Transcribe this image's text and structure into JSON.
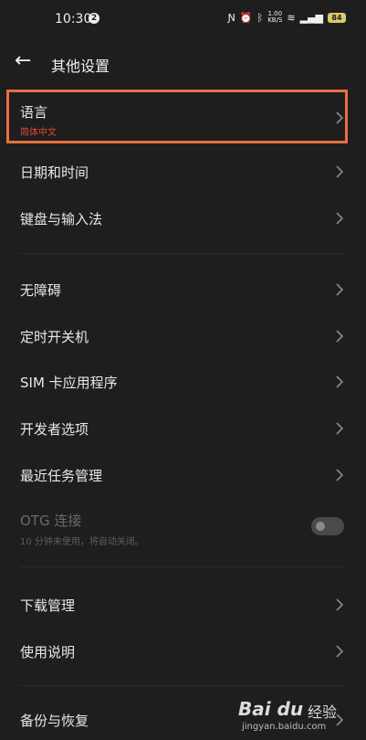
{
  "status": {
    "time": "10:30",
    "notification_count": "2",
    "speed_value": "1.00",
    "speed_unit": "KB/S",
    "battery": "84"
  },
  "header": {
    "title": "其他设置"
  },
  "items": {
    "language": {
      "label": "语言",
      "value": "简体中文"
    },
    "datetime": {
      "label": "日期和时间"
    },
    "keyboard": {
      "label": "键盘与输入法"
    },
    "accessibility": {
      "label": "无障碍"
    },
    "schedule_power": {
      "label": "定时开关机"
    },
    "sim_apps": {
      "label": "SIM 卡应用程序"
    },
    "developer": {
      "label": "开发者选项"
    },
    "recent_tasks": {
      "label": "最近任务管理"
    },
    "otg": {
      "label": "OTG 连接",
      "sub": "10 分钟未使用，将自动关闭。",
      "enabled": false
    },
    "downloads": {
      "label": "下载管理"
    },
    "manual": {
      "label": "使用说明"
    },
    "backup": {
      "label": "备份与恢复"
    }
  },
  "watermark": {
    "logo": "Bai du",
    "brand": "经验",
    "url": "jingyan.baidu.com"
  },
  "colors": {
    "accent_red": "#e0483a",
    "highlight_border": "#e8703f",
    "background": "#1e1e1e"
  }
}
